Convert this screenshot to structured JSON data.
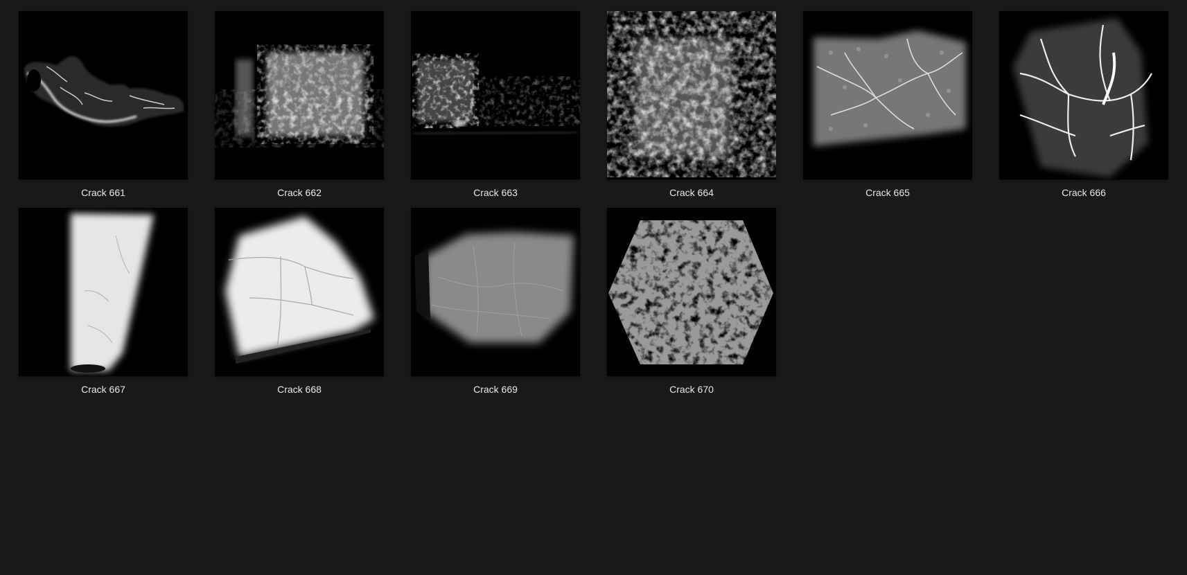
{
  "gallery": {
    "items": [
      {
        "label": "Crack 661",
        "icon": "crack-brush-thumbnail"
      },
      {
        "label": "Crack 662",
        "icon": "crack-brush-thumbnail"
      },
      {
        "label": "Crack 663",
        "icon": "crack-brush-thumbnail"
      },
      {
        "label": "Crack 664",
        "icon": "crack-brush-thumbnail"
      },
      {
        "label": "Crack 665",
        "icon": "crack-brush-thumbnail"
      },
      {
        "label": "Crack 666",
        "icon": "crack-brush-thumbnail"
      },
      {
        "label": "Crack 667",
        "icon": "crack-brush-thumbnail"
      },
      {
        "label": "Crack 668",
        "icon": "crack-brush-thumbnail"
      },
      {
        "label": "Crack 669",
        "icon": "crack-brush-thumbnail"
      },
      {
        "label": "Crack 670",
        "icon": "crack-brush-thumbnail"
      }
    ]
  },
  "colors": {
    "background": "#191919",
    "thumbnail_background": "#000000",
    "caption": "#e8e8e8"
  }
}
